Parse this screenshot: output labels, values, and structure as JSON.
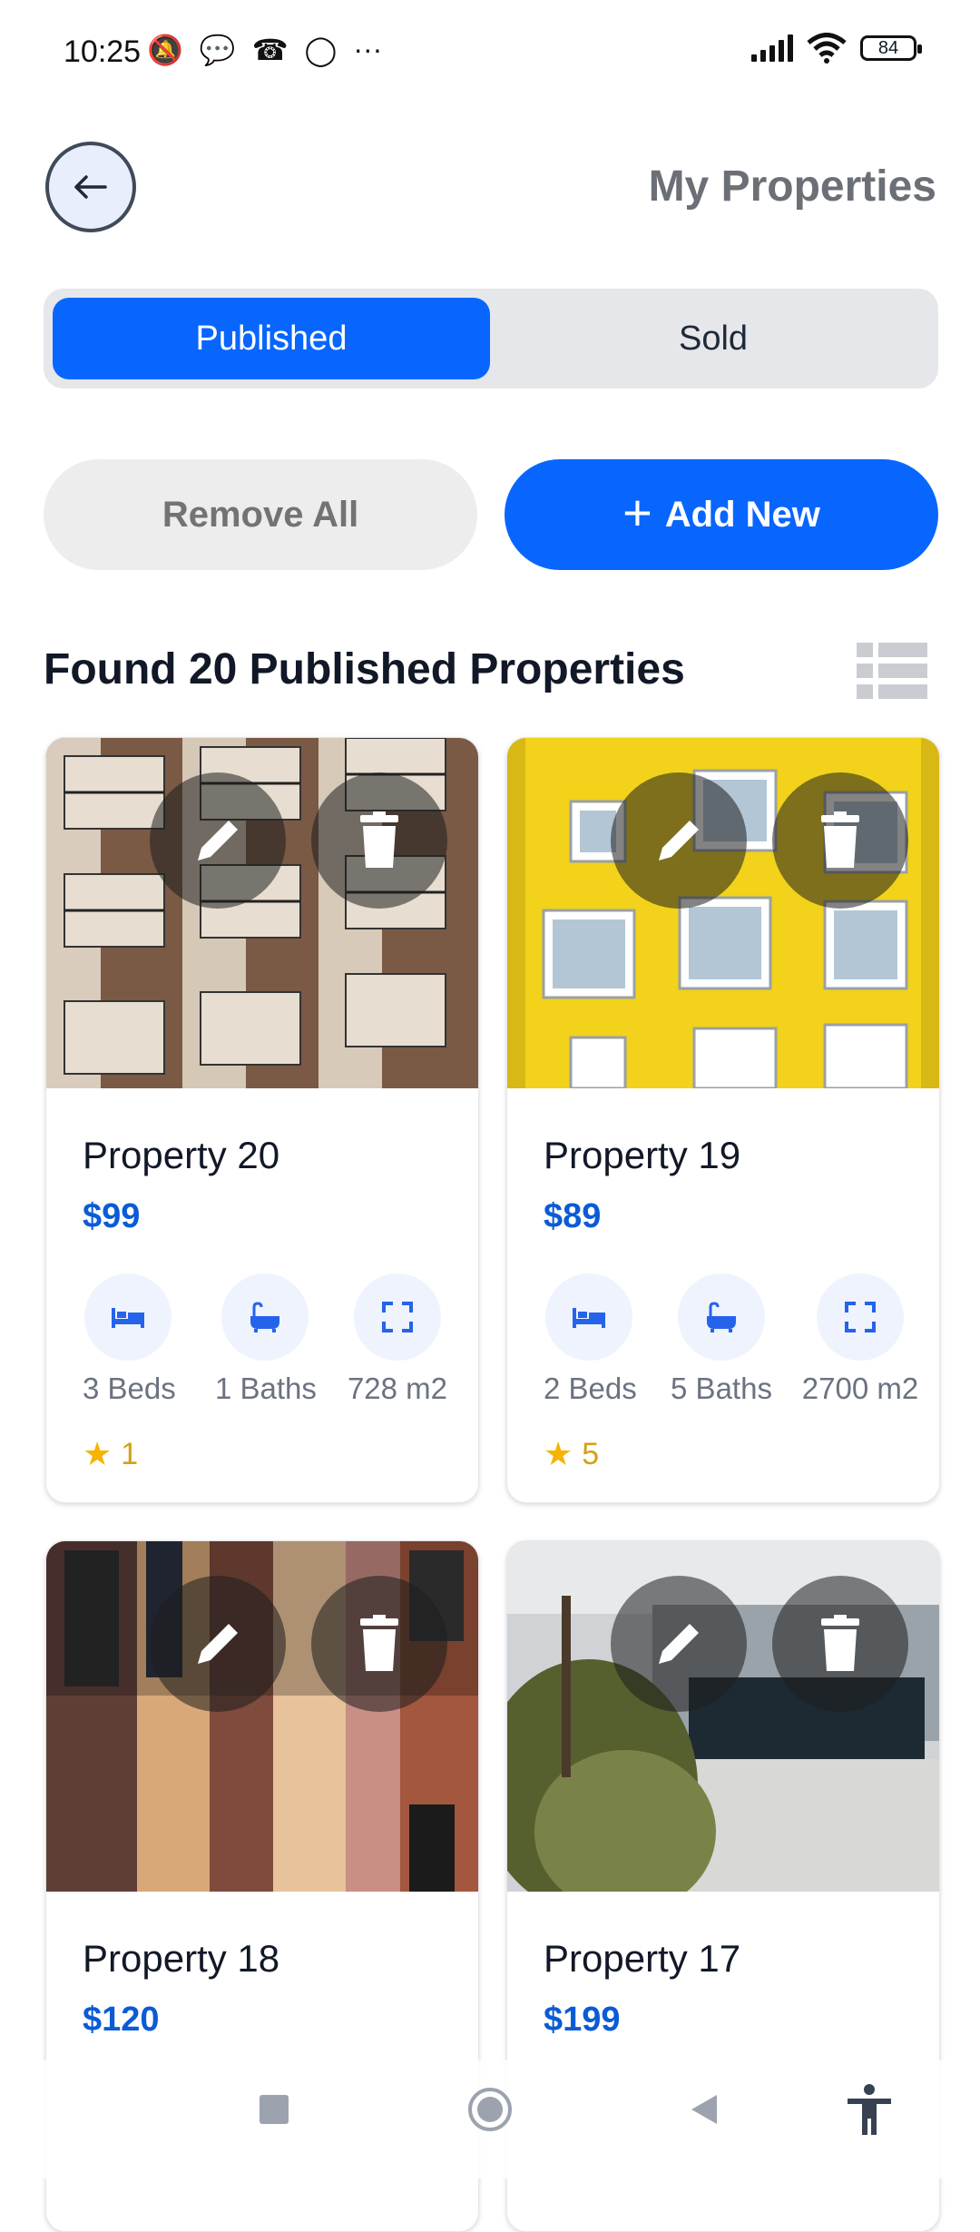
{
  "status": {
    "time": "10:25",
    "battery": "84",
    "left_icons": [
      "mute-icon",
      "chat-icon",
      "missed-call-icon",
      "whatsapp-icon",
      "more-icon"
    ]
  },
  "header": {
    "title": "My Properties"
  },
  "tabs": [
    {
      "label": "Published",
      "active": true
    },
    {
      "label": "Sold",
      "active": false
    }
  ],
  "actions": {
    "remove_all": "Remove All",
    "add_new": "Add New"
  },
  "listing": {
    "heading": "Found 20 Published Properties"
  },
  "properties": [
    {
      "title": "Property 20",
      "price": "$99",
      "beds": "3 Beds",
      "baths": "1 Baths",
      "area": "728 m2",
      "rating": "1"
    },
    {
      "title": "Property 19",
      "price": "$89",
      "beds": "2 Beds",
      "baths": "5 Baths",
      "area": "2700 m2",
      "rating": "5"
    },
    {
      "title": "Property 18",
      "price": "$120"
    },
    {
      "title": "Property 17",
      "price": "$199"
    }
  ],
  "colors": {
    "accent": "#0866ff",
    "price": "#0b5bd6",
    "rating": "#d4a017"
  }
}
